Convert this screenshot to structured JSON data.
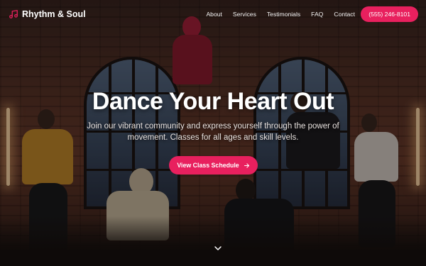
{
  "nav": {
    "brand": "Rhythm & Soul",
    "brand_icon": "music-note-icon",
    "links": [
      "About",
      "Services",
      "Testimonials",
      "FAQ",
      "Contact"
    ],
    "phone": "(555) 246-8101"
  },
  "hero": {
    "title": "Dance Your Heart Out",
    "subtitle": "Join our vibrant community and express yourself through the power of movement. Classes for all ages and skill levels.",
    "cta_label": "View Class Schedule",
    "cta_icon": "arrow-right-icon",
    "scroll_icon": "chevron-down-icon"
  },
  "colors": {
    "accent": "#e8205e",
    "text": "#ffffff"
  }
}
